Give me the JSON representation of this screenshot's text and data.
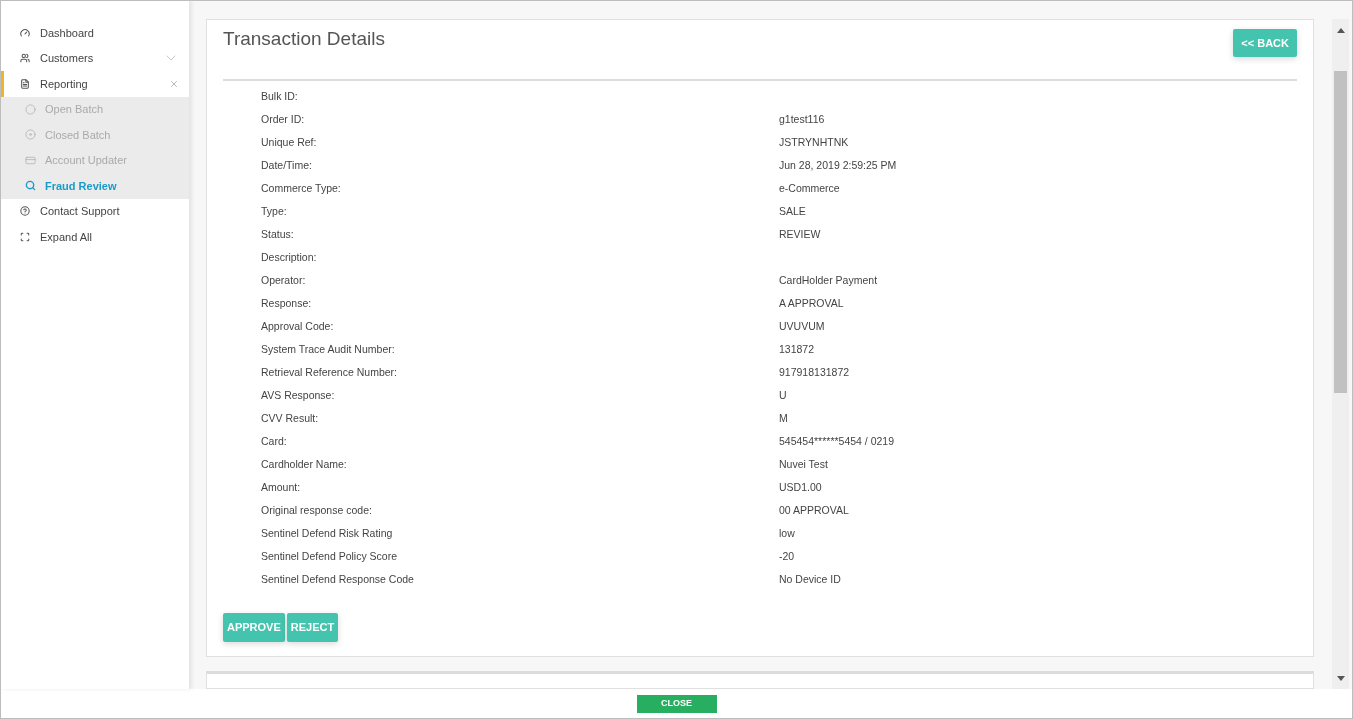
{
  "sidebar": {
    "items": [
      {
        "label": "Dashboard",
        "active": false
      },
      {
        "label": "Customers",
        "active": false,
        "expanded": false
      },
      {
        "label": "Reporting",
        "active": true,
        "expanded": true,
        "children": [
          {
            "label": "Open Batch",
            "selected": false
          },
          {
            "label": "Closed Batch",
            "selected": false
          },
          {
            "label": "Account Updater",
            "selected": false
          },
          {
            "label": "Fraud Review",
            "selected": true
          }
        ]
      },
      {
        "label": "Contact Support",
        "active": false
      },
      {
        "label": "Expand All",
        "active": false
      }
    ]
  },
  "title": "Transaction Details",
  "back_button": "<< BACK",
  "details": [
    {
      "label": "Bulk ID:"
    },
    {
      "label": "Order ID:",
      "value": "g1test116"
    },
    {
      "label": "Unique Ref:",
      "value": "JSTRYNHTNK"
    },
    {
      "label": "Date/Time:",
      "value": "Jun 28, 2019 2:59:25 PM"
    },
    {
      "label": "Commerce Type:",
      "value": "e-Commerce"
    },
    {
      "label": "Type:",
      "value": "SALE"
    },
    {
      "label": "Status:",
      "value": "REVIEW"
    },
    {
      "label": "Description:"
    },
    {
      "label": "Operator:",
      "value": "CardHolder Payment"
    },
    {
      "label": "Response:",
      "value": "A APPROVAL"
    },
    {
      "label": "Approval Code:",
      "value": "UVUVUM"
    },
    {
      "label": "System Trace Audit Number:",
      "value": "131872"
    },
    {
      "label": "Retrieval Reference Number:",
      "value": "917918131872"
    },
    {
      "label": "AVS Response:",
      "value": "U"
    },
    {
      "label": "CVV Result:",
      "value": "M"
    },
    {
      "label": "Card:",
      "value": "545454******5454 / 0219"
    },
    {
      "label": "Cardholder Name:",
      "value": "Nuvei Test"
    },
    {
      "label": "Amount:",
      "value": "USD1.00"
    },
    {
      "label": "Original response code:",
      "value": "00 APPROVAL"
    },
    {
      "label": "Sentinel Defend Risk Rating",
      "value": "low"
    },
    {
      "label": "Sentinel Defend Policy Score",
      "value": "-20"
    },
    {
      "label": "Sentinel Defend Response Code",
      "value": "No Device ID"
    }
  ],
  "actions": [
    "APPROVE",
    "REJECT"
  ],
  "close_button": "CLOSE"
}
